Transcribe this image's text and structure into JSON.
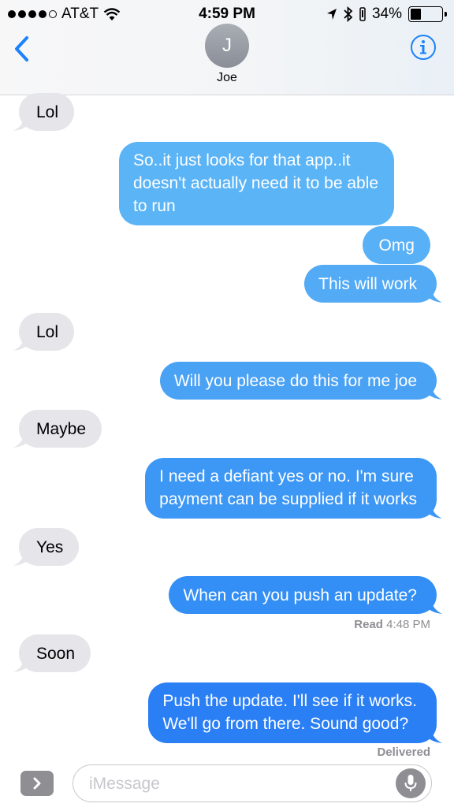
{
  "status_bar": {
    "carrier": "AT&T",
    "time": "4:59 PM",
    "battery_percent": "34%",
    "battery_level": 0.34,
    "signal_bars_filled": 4,
    "signal_bars_total": 5
  },
  "header": {
    "avatar_initial": "J",
    "contact_name": "Joe",
    "back_icon": "chevron-left-icon",
    "info_icon": "info-icon"
  },
  "messages": [
    {
      "direction": "in",
      "text": "Lol"
    },
    {
      "direction": "out",
      "lines": [
        "So..it just looks for that app..it",
        "doesn't actually need it to be able",
        "to run"
      ]
    },
    {
      "direction": "out",
      "text": "Omg"
    },
    {
      "direction": "out",
      "text": "This will work"
    },
    {
      "direction": "in",
      "text": "Lol"
    },
    {
      "direction": "out",
      "text": "Will you please do this for me joe"
    },
    {
      "direction": "in",
      "text": "Maybe"
    },
    {
      "direction": "out",
      "lines": [
        "I need a defiant yes or no. I'm sure",
        "payment can be supplied if it works"
      ]
    },
    {
      "direction": "in",
      "text": "Yes"
    },
    {
      "direction": "out",
      "text": "When can you push an update?"
    },
    {
      "direction": "in",
      "text": "Soon"
    },
    {
      "direction": "out",
      "lines": [
        "Push the update. I'll see if it works.",
        "We'll go from there. Sound good?"
      ]
    }
  ],
  "receipts": {
    "read_label": "Read",
    "read_time": "4:48 PM",
    "delivered": "Delivered"
  },
  "input": {
    "placeholder": "iMessage"
  },
  "colors": {
    "accent": "#1a82fb",
    "incoming_bubble": "#e5e5ea",
    "outgoing_light": "#5bb4f6",
    "outgoing_dark": "#2a7ff5",
    "icon_gray": "#8e8e93"
  }
}
